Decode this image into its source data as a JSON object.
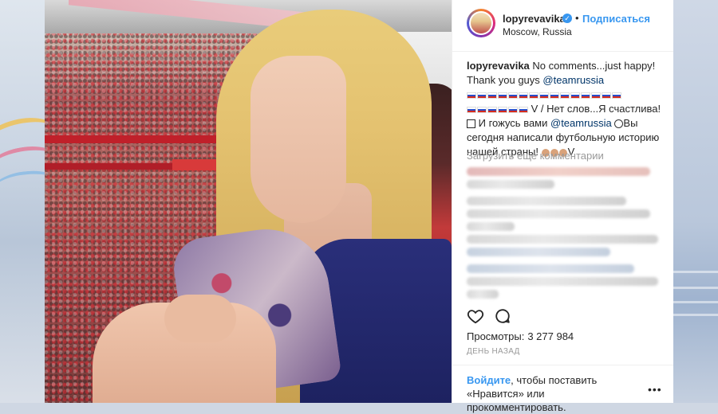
{
  "post": {
    "username": "lopyrevavika",
    "verified_icon": "verified-badge-icon",
    "separator": "•",
    "follow_label": "Подписаться",
    "location": "Moscow, Russia"
  },
  "caption": {
    "username": "lopyrevavika",
    "line1": " No comments...just happy! Thank you guys ",
    "mention": "@teamrussia",
    "mid_text": "V / Нет слов...Я счастлива!",
    "line3": " И гожусь вами ",
    "line4": "Вы сегодня написали футбольную историю нашей страны! ",
    "end_text": "V"
  },
  "comments": {
    "load_more": "Загрузить еще комментарии"
  },
  "stats": {
    "views_label": "Просмотры:",
    "views_value": "3 277 984",
    "time": "ДЕНЬ НАЗАД"
  },
  "footer": {
    "login_label": "Войдите",
    "text_after_login": ", чтобы поставить «Нравится» или прокомментировать.",
    "more_label": "•••"
  },
  "colors": {
    "link_blue": "#3897f0",
    "text": "#262626",
    "muted": "#999999",
    "mention": "#003569"
  }
}
